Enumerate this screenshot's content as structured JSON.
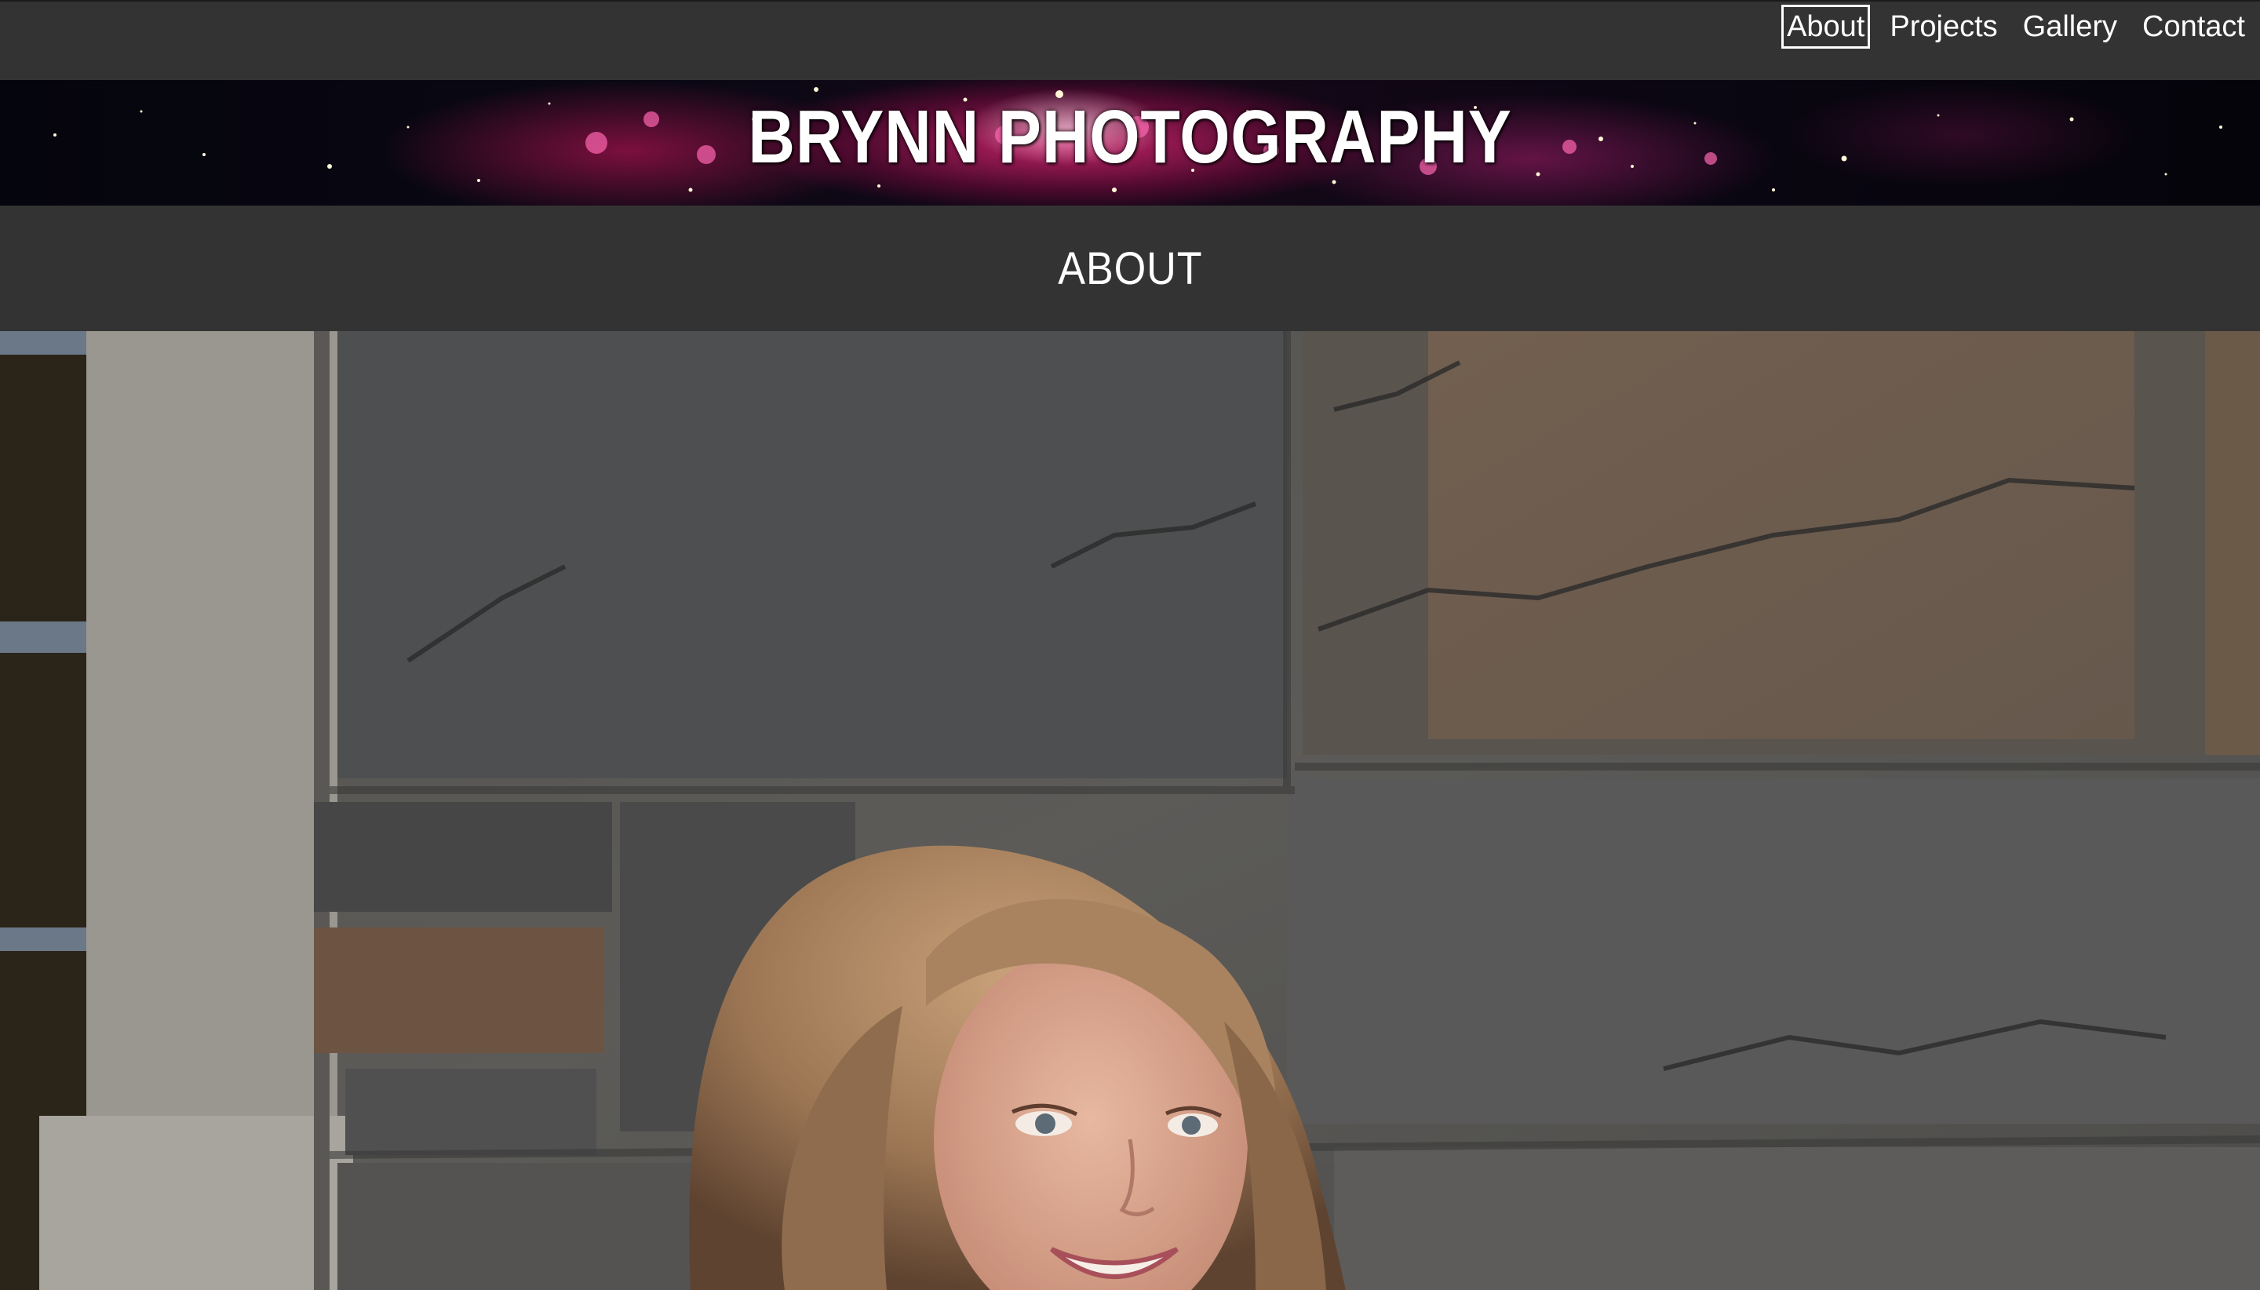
{
  "nav": {
    "items": [
      {
        "label": "About",
        "active": true
      },
      {
        "label": "Projects",
        "active": false
      },
      {
        "label": "Gallery",
        "active": false
      },
      {
        "label": "Contact",
        "active": false
      }
    ]
  },
  "banner": {
    "title": "BRYNN PHOTOGRAPHY"
  },
  "section": {
    "title": "ABOUT"
  },
  "colors": {
    "nav_background": "#333333",
    "text": "#ffffff",
    "banner_accent": "#e02878"
  }
}
